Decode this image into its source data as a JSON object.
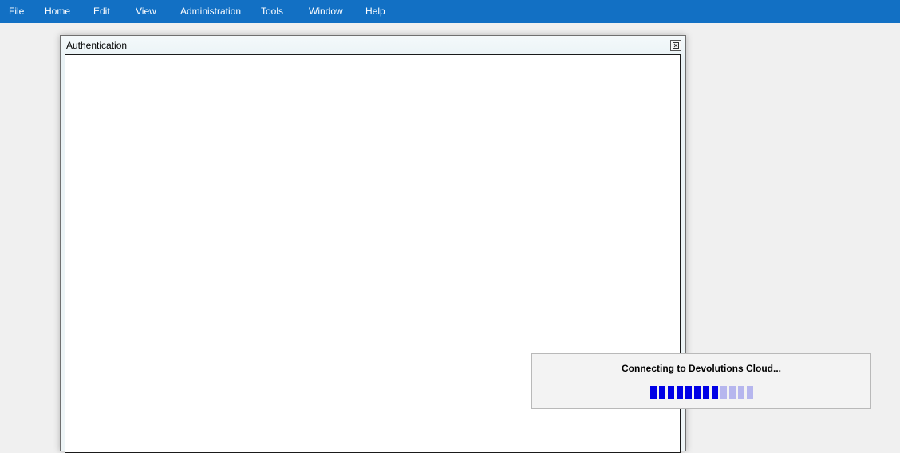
{
  "menubar": {
    "items": [
      "File",
      "Home",
      "Edit",
      "View",
      "Administration",
      "Tools",
      "Window",
      "Help"
    ],
    "background": "#1270c4"
  },
  "dialog": {
    "title": "Authentication",
    "close_icon": "close-icon"
  },
  "toast": {
    "message": "Connecting to Devolutions Cloud...",
    "progress": {
      "segments_total": 12,
      "segments_filled": 8,
      "filled_color": "#0000e6",
      "empty_color": "#b6b6ee"
    }
  }
}
